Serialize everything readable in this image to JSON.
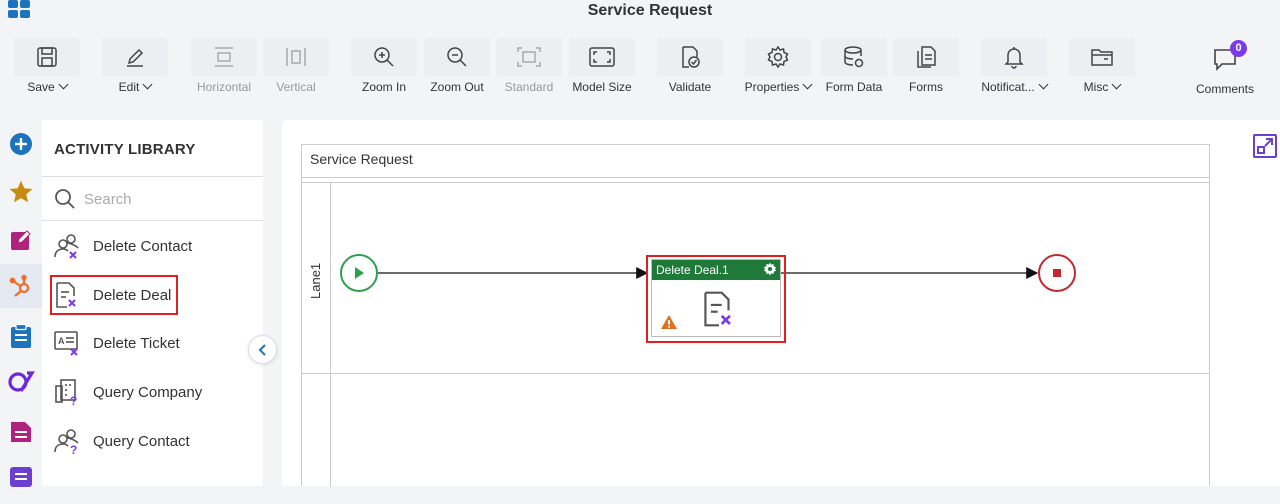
{
  "window": {
    "title": "Service Request"
  },
  "toolbar": {
    "save": "Save",
    "edit": "Edit",
    "horizontal": "Horizontal",
    "vertical": "Vertical",
    "zoom_in": "Zoom In",
    "zoom_out": "Zoom Out",
    "standard": "Standard",
    "model_size": "Model Size",
    "validate": "Validate",
    "properties": "Properties",
    "form_data": "Form Data",
    "forms": "Forms",
    "notifications": "Notificat...",
    "misc": "Misc",
    "comments": "Comments",
    "comments_count": "0"
  },
  "library": {
    "title": "ACTIVITY LIBRARY",
    "search_placeholder": "Search",
    "items": [
      {
        "label": "Delete Contact",
        "icon": "delete-contact-icon"
      },
      {
        "label": "Delete Deal",
        "icon": "delete-deal-icon",
        "selected": true
      },
      {
        "label": "Delete Ticket",
        "icon": "delete-ticket-icon"
      },
      {
        "label": "Query Company",
        "icon": "query-company-icon"
      },
      {
        "label": "Query Contact",
        "icon": "query-contact-icon"
      }
    ]
  },
  "canvas": {
    "pool_title": "Service Request",
    "lane_label": "Lane1",
    "task_title": "Delete Deal.1"
  },
  "colors": {
    "accent_blue": "#1e73be",
    "task_header": "#1f7a3a",
    "start_event": "#2e9e4f",
    "end_event": "#c0282d",
    "highlight": "#e02020",
    "purple": "#7c3aed"
  }
}
